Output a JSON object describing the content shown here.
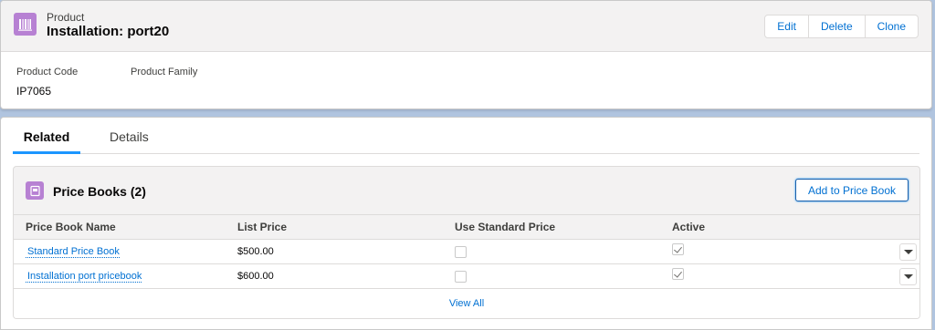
{
  "header": {
    "object_label": "Product",
    "record_name": "Installation: port20",
    "actions": [
      "Edit",
      "Delete",
      "Clone"
    ]
  },
  "fields": [
    {
      "label": "Product Code",
      "value": "IP7065"
    },
    {
      "label": "Product Family",
      "value": ""
    }
  ],
  "tabs": [
    {
      "label": "Related",
      "active": true
    },
    {
      "label": "Details",
      "active": false
    }
  ],
  "related": {
    "title": "Price Books (2)",
    "add_button": "Add to Price Book",
    "columns": [
      "Price Book Name",
      "List Price",
      "Use Standard Price",
      "Active"
    ],
    "rows": [
      {
        "name": "Standard Price Book",
        "price": "$500.00",
        "use_standard": false,
        "active": true
      },
      {
        "name": "Installation port pricebook",
        "price": "$600.00",
        "use_standard": false,
        "active": true
      }
    ],
    "view_all": "View All"
  },
  "colors": {
    "accent": "#0070d2",
    "product_icon": "#b781d3",
    "tab_indicator": "#1b96ff"
  },
  "icons": [
    "product-icon",
    "price-book-icon",
    "row-actions-chevron-icon"
  ]
}
